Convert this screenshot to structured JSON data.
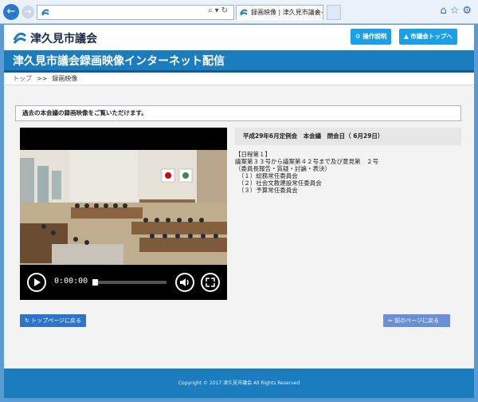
{
  "browser": {
    "address_icon": "site-icon",
    "tab_title": "録画映像 | 津久見市議会イ...",
    "close_glyph": "×"
  },
  "site": {
    "name": "津久見市議会",
    "buttons": {
      "help": "操作説明",
      "top": "市議会トップへ"
    },
    "banner": "津久見市議会録画映像インターネット配信"
  },
  "breadcrumb": {
    "home": "トップ",
    "separator": ">>",
    "current": "録画映像"
  },
  "notice": "過去の本会議の録画映像をご覧いただけます。",
  "player": {
    "time": "0:00:00",
    "progress": 0
  },
  "meeting": {
    "title": "平成29年6月定例会　本会議　閉会日（ 6月29日）",
    "agenda": [
      "【日程第１】",
      "議案第３３号から議案第４２号まで及び意見第　２号",
      "（委員長報告・質疑・討論・表決）",
      "　（１）総務常任委員会",
      "　（２）社会文教建設常任委員会",
      "　（３）予算常任委員会"
    ]
  },
  "nav": {
    "back_top": "トップページに戻る",
    "prev": "前のページに戻る"
  },
  "footer": "Copyright © 2017 津久見市議会 All Rights Reserved",
  "colors": {
    "banner": "#1b7dbd",
    "accent_button": "#1aa0e6",
    "back_button": "#2e74c8",
    "prev_button": "#6a8fd4"
  }
}
